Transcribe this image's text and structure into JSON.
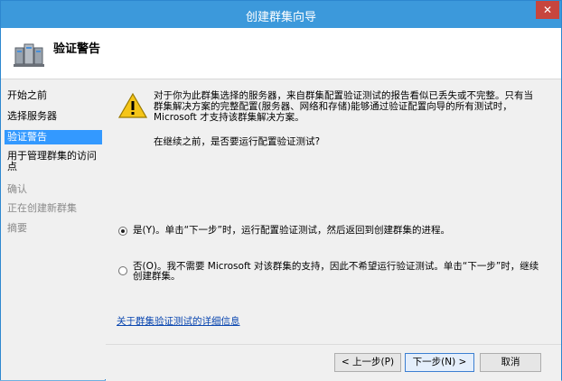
{
  "window": {
    "title": "创建群集向导",
    "close_label": "✕"
  },
  "header": {
    "title": "验证警告"
  },
  "nav": {
    "items": [
      {
        "label": "开始之前",
        "state": "normal"
      },
      {
        "label": "选择服务器",
        "state": "normal"
      },
      {
        "label": "验证警告",
        "state": "selected"
      },
      {
        "label": "用于管理群集的访问点",
        "state": "normal"
      },
      {
        "label": "确认",
        "state": "disabled"
      },
      {
        "label": "正在创建新群集",
        "state": "disabled"
      },
      {
        "label": "摘要",
        "state": "disabled"
      }
    ]
  },
  "content": {
    "warning_text": "对于你为此群集选择的服务器，来自群集配置验证测试的报告看似已丢失或不完整。只有当群集解决方案的完整配置(服务器、网络和存储)能够通过验证配置向导的所有测试时，Microsoft 才支持该群集解决方案。",
    "question": "在继续之前，是否要运行配置验证测试?",
    "options": [
      {
        "label": "是(Y)。单击“下一步”时，运行配置验证测试，然后返回到创建群集的进程。",
        "checked": true
      },
      {
        "label": "否(O)。我不需要 Microsoft 对该群集的支持，因此不希望运行验证测试。单击“下一步”时，继续创建群集。",
        "checked": false
      }
    ],
    "details_link": "关于群集验证测试的详细信息"
  },
  "footer": {
    "back_label": "< 上一步(P)",
    "next_label": "下一步(N) >",
    "cancel_label": "取消"
  }
}
